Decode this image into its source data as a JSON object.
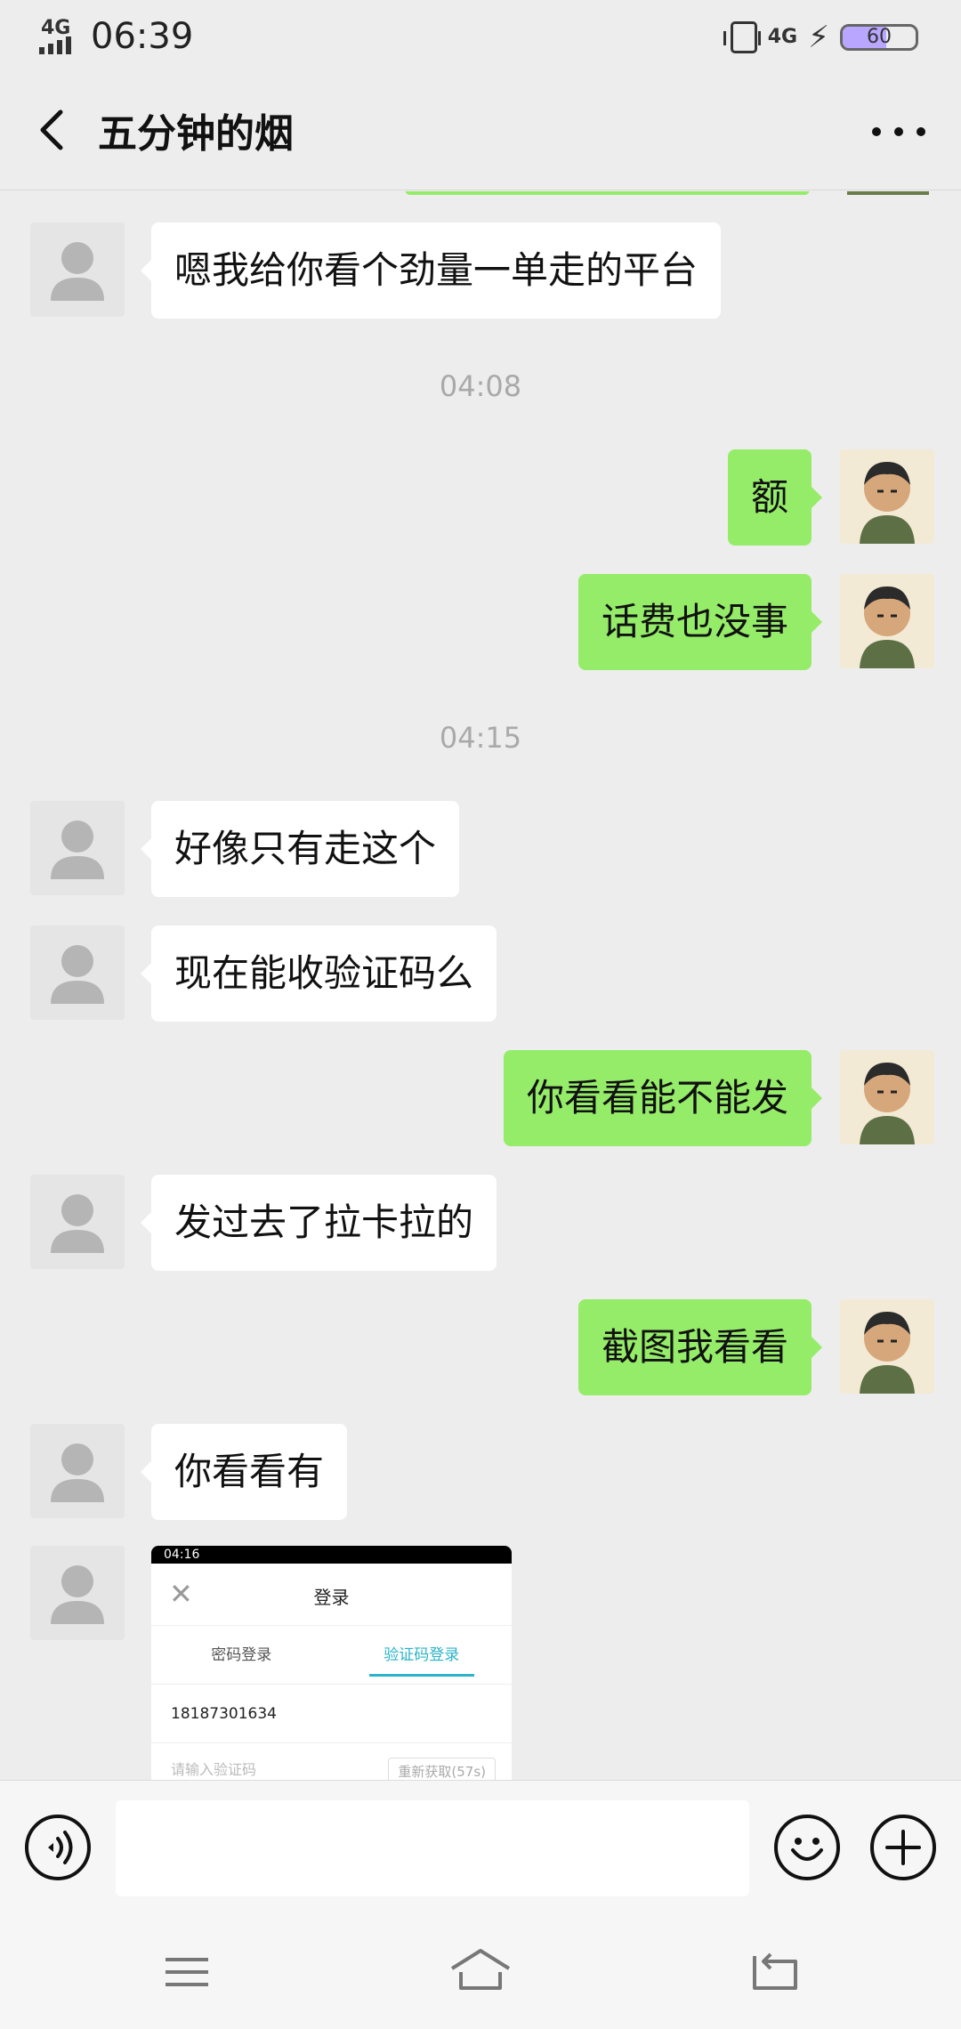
{
  "status_bar": {
    "network_left": "4G",
    "time": "06:39",
    "network_right": "4G",
    "battery": "60",
    "battery_level": 0.6
  },
  "header": {
    "title": "五分钟的烟"
  },
  "messages": [
    {
      "from": "contact",
      "text": "嗯我给你看个劲量一单走的平台"
    },
    {
      "timestamp": "04:08"
    },
    {
      "from": "me",
      "text": "额"
    },
    {
      "from": "me",
      "text": "话费也没事"
    },
    {
      "timestamp": "04:15"
    },
    {
      "from": "contact",
      "text": "好像只有走这个"
    },
    {
      "from": "contact",
      "text": "现在能收验证码么"
    },
    {
      "from": "me",
      "text": "你看看能不能发"
    },
    {
      "from": "contact",
      "text": "发过去了拉卡拉的"
    },
    {
      "from": "me",
      "text": "截图我看看"
    },
    {
      "from": "contact",
      "text": "你看看有"
    }
  ],
  "screenshot_message": {
    "status_time": "04:16",
    "title": "登录",
    "tab_password": "密码登录",
    "tab_code": "验证码登录",
    "phone": "18187301634",
    "code_placeholder": "请输入验证码",
    "resend": "重新获取(57s)"
  },
  "input": {
    "placeholder": ""
  },
  "icons": {
    "back": "back-arrow-icon",
    "more": "more-dots-icon",
    "voice": "voice-icon",
    "emoji": "emoji-icon",
    "plus": "plus-icon",
    "nav_menu": "menu-icon",
    "nav_home": "home-icon",
    "nav_back": "back-icon"
  }
}
